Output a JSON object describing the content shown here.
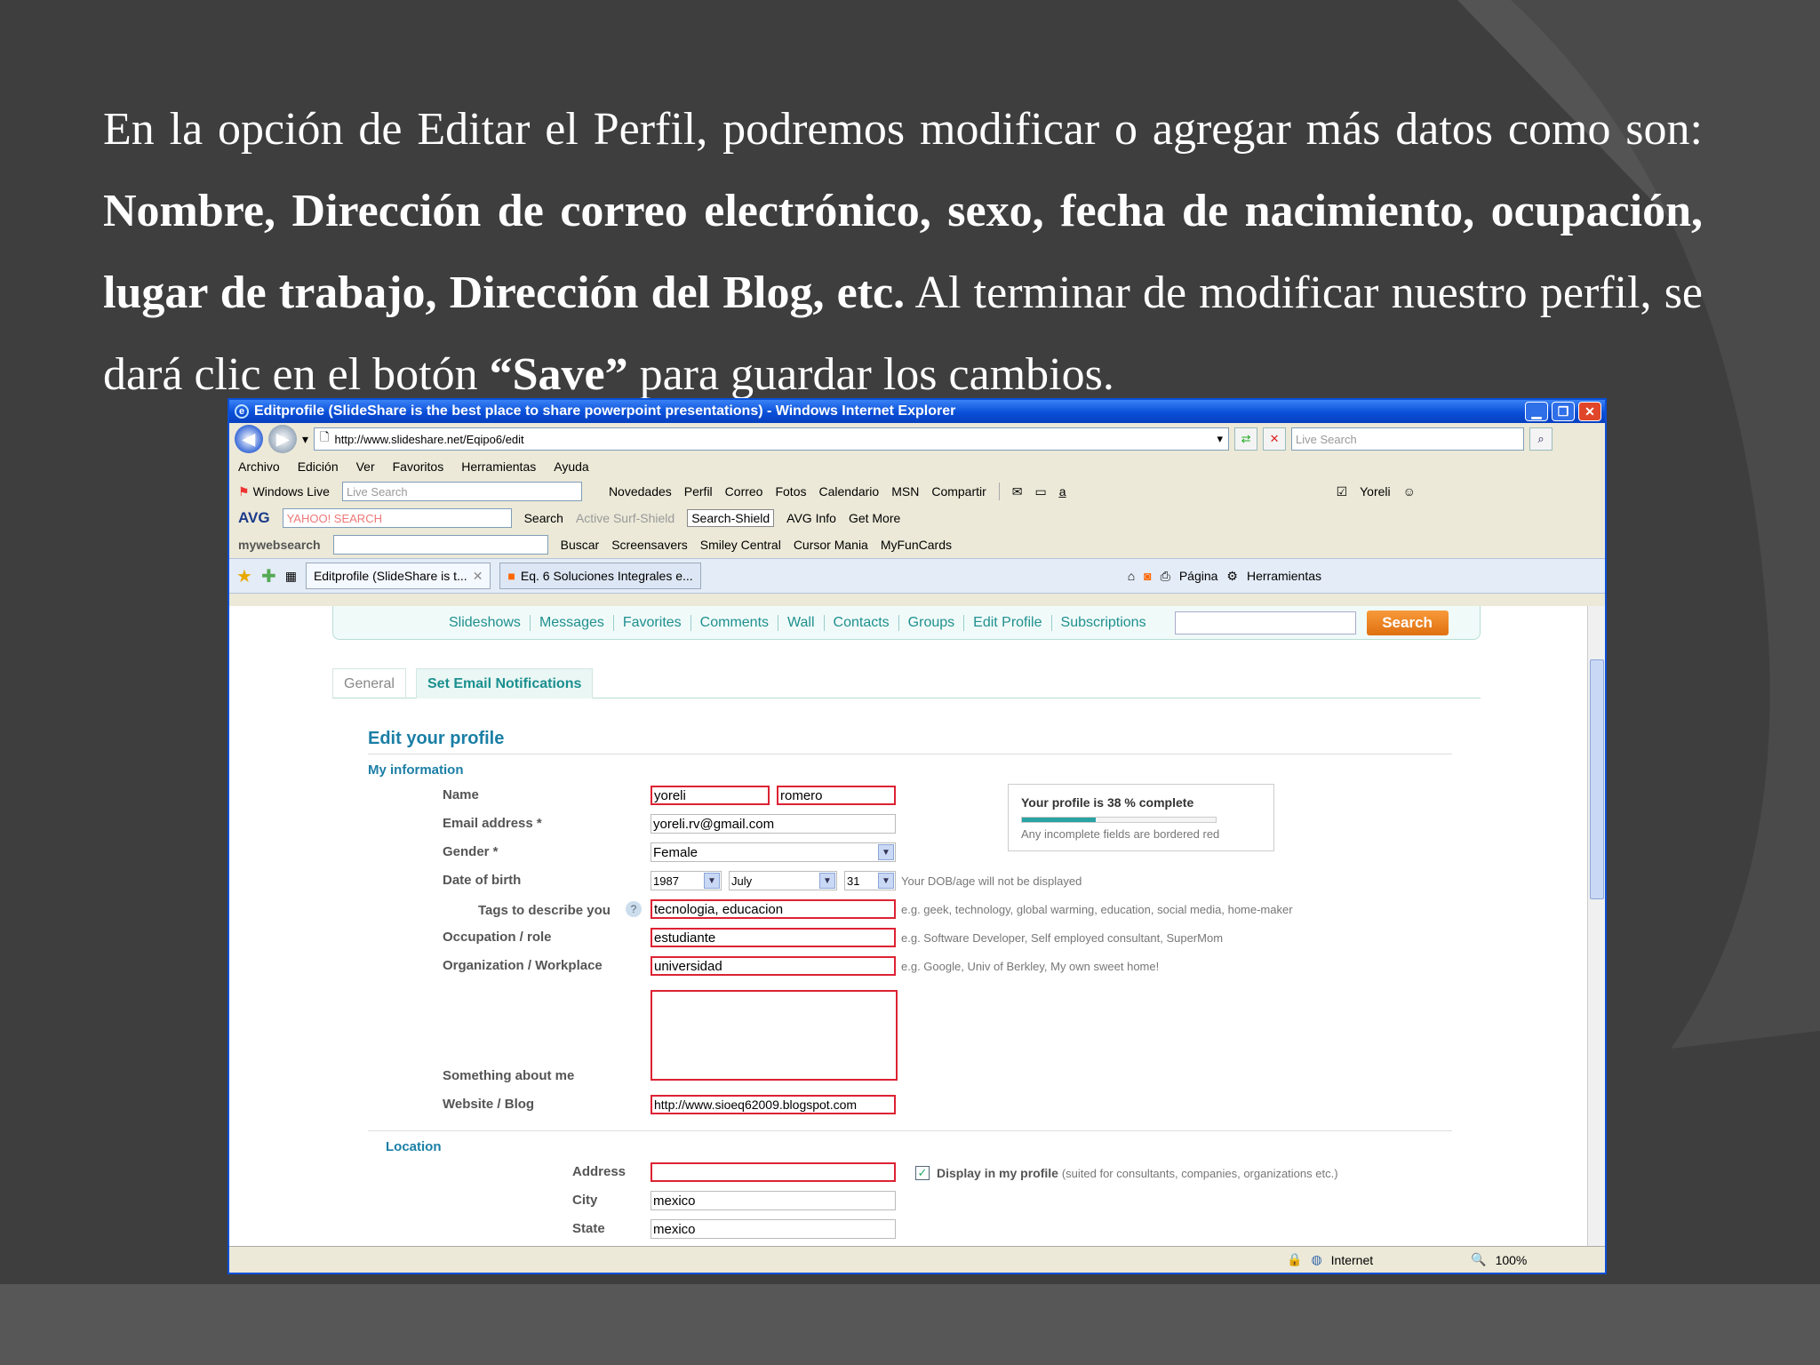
{
  "caption": {
    "p1": "En la opción de Editar el Perfil, podremos modificar o agregar más datos como son: ",
    "b1": "Nombre, Dirección de correo electrónico, sexo, fecha de nacimiento, ocupación, lugar de trabajo, Dirección del Blog, etc.",
    "p2": " Al terminar de modificar nuestro perfil, se dará clic en el botón ",
    "b2": "“Save”",
    "p3": " para guardar los cambios."
  },
  "window": {
    "title": "Editprofile (SlideShare is the best place to share powerpoint presentations) - Windows Internet Explorer",
    "url": "http://www.slideshare.net/Eqipo6/edit",
    "search_placeholder": "Live Search"
  },
  "menu": [
    "Archivo",
    "Edición",
    "Ver",
    "Favoritos",
    "Herramientas",
    "Ayuda"
  ],
  "wl_toolbar": {
    "brand": "Windows Live",
    "search_placeholder": "Live Search",
    "items": [
      "Novedades",
      "Perfil",
      "Correo",
      "Fotos",
      "Calendario",
      "MSN",
      "Compartir"
    ],
    "user": "Yoreli"
  },
  "avg_toolbar": {
    "brand": "AVG",
    "search_placeholder": "YAHOO! SEARCH",
    "search": "Search",
    "active_surf": "Active Surf-Shield",
    "search_shield": "Search-Shield",
    "avg_info": "AVG Info",
    "get_more": "Get More"
  },
  "mws_toolbar": {
    "brand": "mywebsearch",
    "buscar": "Buscar",
    "items": [
      "Screensavers",
      "Smiley Central",
      "Cursor Mania",
      "MyFunCards"
    ]
  },
  "tabs": [
    {
      "label": "Editprofile (SlideShare is t..."
    },
    {
      "label": "Eq. 6 Soluciones Integrales e..."
    }
  ],
  "cmd": {
    "pagina": "Página",
    "herramientas": "Herramientas"
  },
  "ss_nav": [
    "Slideshows",
    "Messages",
    "Favorites",
    "Comments",
    "Wall",
    "Contacts",
    "Groups",
    "Edit Profile",
    "Subscriptions"
  ],
  "ss_search": "Search",
  "profile_tabs": [
    "General",
    "Set Email Notifications"
  ],
  "form": {
    "heading": "Edit your profile",
    "section": "My information",
    "name_label": "Name",
    "first_name": "yoreli",
    "last_name": "romero",
    "email_label": "Email address *",
    "email": "yoreli.rv@gmail.com",
    "gender_label": "Gender *",
    "gender": "Female",
    "dob_label": "Date of birth",
    "dob_year": "1987",
    "dob_month": "July",
    "dob_day": "31",
    "dob_hint": "Your DOB/age will not be displayed",
    "tags_label": "Tags to describe you",
    "tags": "tecnologia, educacion",
    "tags_hint": "e.g. geek, technology, global warming, education, social media, home-maker",
    "occupation_label": "Occupation / role",
    "occupation": "estudiante",
    "occupation_hint": "e.g. Software Developer, Self employed consultant, SuperMom",
    "org_label": "Organization / Workplace",
    "org": "universidad",
    "org_hint": "e.g. Google, Univ of Berkley, My own sweet home!",
    "about_label": "Something about me",
    "website_label": "Website / Blog",
    "website": "http://www.sioeq62009.blogspot.com",
    "location_section": "Location",
    "address_label": "Address",
    "city_label": "City",
    "city": "mexico",
    "state_label": "State",
    "state": "mexico",
    "display_label": "Display in my profile",
    "display_hint": "(suited for consultants, companies, organizations etc.)"
  },
  "completeness": {
    "title": "Your profile is 38 % complete",
    "hint": "Any incomplete fields are bordered red",
    "percent": 38
  },
  "statusbar": {
    "zone": "Internet",
    "zoom": "100%"
  }
}
